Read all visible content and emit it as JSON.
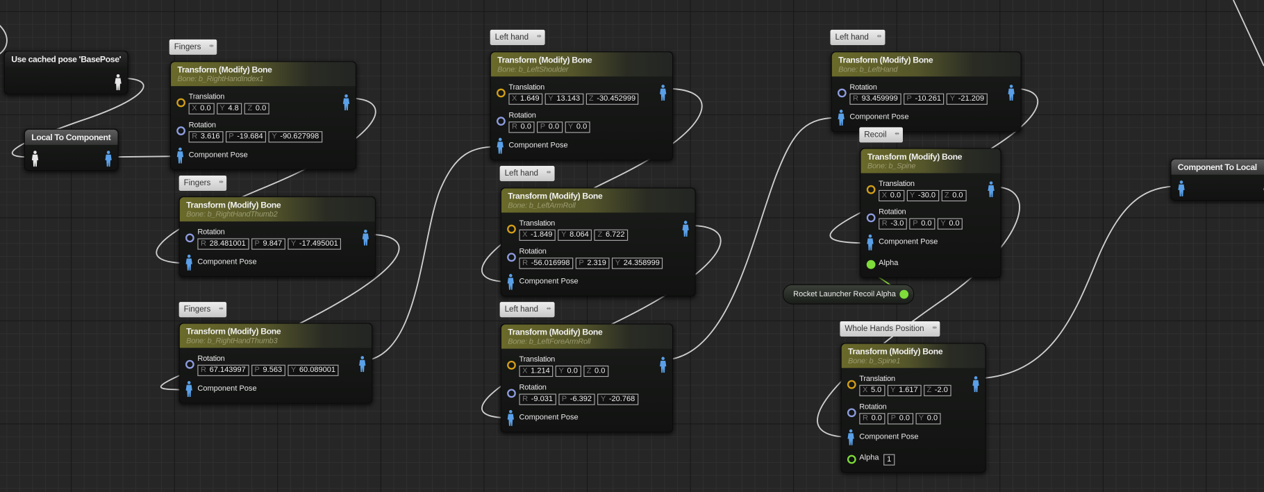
{
  "colors": {
    "translation_pin": "#d4a017",
    "rotation_pin": "#8f9de0",
    "pose_pin": "#5aa0e8",
    "local_pose_pin": "#e8e8e8",
    "alpha_pin": "#7fdc3a",
    "header": "#6a6a2a",
    "wire": "#cfcfcf"
  },
  "icons": {
    "pose": "person-figure-icon",
    "pin": "circle-pin-icon",
    "comment_pin": "pin-icon"
  },
  "simple_nodes": [
    {
      "title": "Use cached pose 'BasePose'",
      "pins": [
        "output-local"
      ]
    },
    {
      "title": "Local To Component",
      "pins": [
        "input-local",
        "output-component"
      ]
    },
    {
      "title": "Component To Local",
      "pins": [
        "input-component",
        "output-local"
      ]
    }
  ],
  "variable_node": {
    "label": "Rocket Launcher Recoil Alpha"
  },
  "transform_nodes": [
    {
      "comment": "Fingers",
      "title": "Transform (Modify) Bone",
      "bone": "Bone: b_RightHandIndex1",
      "rows": [
        {
          "type": "translation",
          "label": "Translation",
          "fields": [
            {
              "axis": "X",
              "value": "0.0"
            },
            {
              "axis": "Y",
              "value": "4.8"
            },
            {
              "axis": "Z",
              "value": "0.0"
            }
          ]
        },
        {
          "type": "rotation",
          "label": "Rotation",
          "fields": [
            {
              "axis": "R",
              "value": "3.616"
            },
            {
              "axis": "P",
              "value": "-19.684"
            },
            {
              "axis": "Y",
              "value": "-90.627998"
            }
          ]
        }
      ],
      "pose_label": "Component Pose"
    },
    {
      "comment": "Fingers",
      "title": "Transform (Modify) Bone",
      "bone": "Bone: b_RightHandThumb2",
      "rows": [
        {
          "type": "rotation",
          "label": "Rotation",
          "fields": [
            {
              "axis": "R",
              "value": "28.481001"
            },
            {
              "axis": "P",
              "value": "9.847"
            },
            {
              "axis": "Y",
              "value": "-17.495001"
            }
          ]
        }
      ],
      "pose_label": "Component Pose"
    },
    {
      "comment": "Fingers",
      "title": "Transform (Modify) Bone",
      "bone": "Bone: b_RightHandThumb3",
      "rows": [
        {
          "type": "rotation",
          "label": "Rotation",
          "fields": [
            {
              "axis": "R",
              "value": "67.143997"
            },
            {
              "axis": "P",
              "value": "9.563"
            },
            {
              "axis": "Y",
              "value": "60.089001"
            }
          ]
        }
      ],
      "pose_label": "Component Pose"
    },
    {
      "comment": "Left hand",
      "title": "Transform (Modify) Bone",
      "bone": "Bone: b_LeftShoulder",
      "rows": [
        {
          "type": "translation",
          "label": "Translation",
          "fields": [
            {
              "axis": "X",
              "value": "1.649"
            },
            {
              "axis": "Y",
              "value": "13.143"
            },
            {
              "axis": "Z",
              "value": "-30.452999"
            }
          ]
        },
        {
          "type": "rotation",
          "label": "Rotation",
          "fields": [
            {
              "axis": "R",
              "value": "0.0"
            },
            {
              "axis": "P",
              "value": "0.0"
            },
            {
              "axis": "Y",
              "value": "0.0"
            }
          ]
        }
      ],
      "pose_label": "Component Pose"
    },
    {
      "comment": "Left hand",
      "title": "Transform (Modify) Bone",
      "bone": "Bone: b_LeftArmRoll",
      "rows": [
        {
          "type": "translation",
          "label": "Translation",
          "fields": [
            {
              "axis": "X",
              "value": "-1.849"
            },
            {
              "axis": "Y",
              "value": "8.064"
            },
            {
              "axis": "Z",
              "value": "6.722"
            }
          ]
        },
        {
          "type": "rotation",
          "label": "Rotation",
          "fields": [
            {
              "axis": "R",
              "value": "-56.016998"
            },
            {
              "axis": "P",
              "value": "2.319"
            },
            {
              "axis": "Y",
              "value": "24.358999"
            }
          ]
        }
      ],
      "pose_label": "Component Pose"
    },
    {
      "comment": "Left hand",
      "title": "Transform (Modify) Bone",
      "bone": "Bone: b_LeftForeArmRoll",
      "rows": [
        {
          "type": "translation",
          "label": "Translation",
          "fields": [
            {
              "axis": "X",
              "value": "1.214"
            },
            {
              "axis": "Y",
              "value": "0.0"
            },
            {
              "axis": "Z",
              "value": "0.0"
            }
          ]
        },
        {
          "type": "rotation",
          "label": "Rotation",
          "fields": [
            {
              "axis": "R",
              "value": "-9.031"
            },
            {
              "axis": "P",
              "value": "-6.392"
            },
            {
              "axis": "Y",
              "value": "-20.768"
            }
          ]
        }
      ],
      "pose_label": "Component Pose"
    },
    {
      "comment": "Left hand",
      "title": "Transform (Modify) Bone",
      "bone": "Bone: b_LeftHand",
      "rows": [
        {
          "type": "rotation",
          "label": "Rotation",
          "fields": [
            {
              "axis": "R",
              "value": "93.459999"
            },
            {
              "axis": "P",
              "value": "-10.261"
            },
            {
              "axis": "Y",
              "value": "-21.209"
            }
          ]
        }
      ],
      "pose_label": "Component Pose"
    },
    {
      "comment": "Recoil",
      "title": "Transform (Modify) Bone",
      "bone": "Bone: b_Spine",
      "rows": [
        {
          "type": "translation",
          "label": "Translation",
          "fields": [
            {
              "axis": "X",
              "value": "0.0"
            },
            {
              "axis": "Y",
              "value": "-30.0"
            },
            {
              "axis": "Z",
              "value": "0.0"
            }
          ]
        },
        {
          "type": "rotation",
          "label": "Rotation",
          "fields": [
            {
              "axis": "R",
              "value": "-3.0"
            },
            {
              "axis": "P",
              "value": "0.0"
            },
            {
              "axis": "Y",
              "value": "0.0"
            }
          ]
        }
      ],
      "pose_label": "Component Pose",
      "alpha": {
        "label": "Alpha",
        "connected": true
      }
    },
    {
      "comment": "Whole Hands Position",
      "title": "Transform (Modify) Bone",
      "bone": "Bone: b_Spine1",
      "rows": [
        {
          "type": "translation",
          "label": "Translation",
          "fields": [
            {
              "axis": "X",
              "value": "5.0"
            },
            {
              "axis": "Y",
              "value": "1.617"
            },
            {
              "axis": "Z",
              "value": "-2.0"
            }
          ]
        },
        {
          "type": "rotation",
          "label": "Rotation",
          "fields": [
            {
              "axis": "R",
              "value": "0.0"
            },
            {
              "axis": "P",
              "value": "0.0"
            },
            {
              "axis": "Y",
              "value": "0.0"
            }
          ]
        }
      ],
      "pose_label": "Component Pose",
      "alpha": {
        "label": "Alpha",
        "connected": false,
        "value": "1"
      }
    }
  ]
}
